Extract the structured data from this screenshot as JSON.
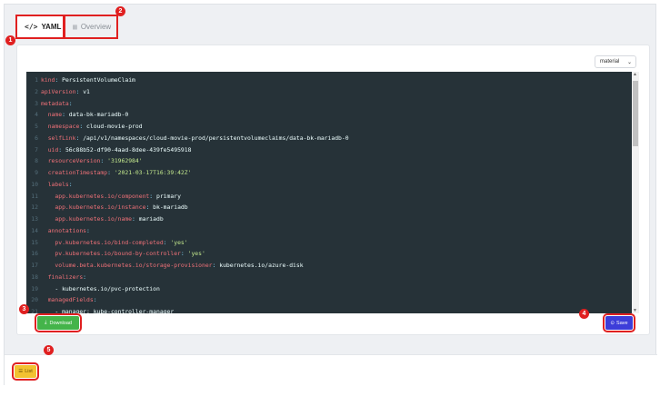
{
  "tabs": [
    {
      "label": "YAML",
      "icon": "code-icon"
    },
    {
      "label": "Overview",
      "icon": "grid-icon"
    }
  ],
  "theme_select": {
    "value": "material"
  },
  "editor": {
    "lines": [
      {
        "n": "1",
        "key": "kind",
        "val": " PersistentVolumeClaim",
        "cls": "v"
      },
      {
        "n": "2",
        "key": "apiVersion",
        "val": " v1",
        "cls": "v"
      },
      {
        "n": "3",
        "key": "metadata",
        "val": "",
        "cls": "v"
      },
      {
        "n": "4",
        "key": "  name",
        "val": " data-bk-mariadb-0",
        "cls": "v"
      },
      {
        "n": "5",
        "key": "  namespace",
        "val": " cloud-movie-prod",
        "cls": "v"
      },
      {
        "n": "6",
        "key": "  selfLink",
        "val": " /api/v1/namespaces/cloud-movie-prod/persistentvolumeclaims/data-bk-mariadb-0",
        "cls": "v"
      },
      {
        "n": "7",
        "key": "  uid",
        "val": " 56c88b52-df90-4aad-8dee-439fe5495918",
        "cls": "v"
      },
      {
        "n": "8",
        "key": "  resourceVersion",
        "val": " '31962984'",
        "cls": "s"
      },
      {
        "n": "9",
        "key": "  creationTimestamp",
        "val": " '2021-03-17T16:39:42Z'",
        "cls": "s"
      },
      {
        "n": "10",
        "key": "  labels",
        "val": "",
        "cls": "v"
      },
      {
        "n": "11",
        "key": "    app.kubernetes.io/component",
        "val": " primary",
        "cls": "v"
      },
      {
        "n": "12",
        "key": "    app.kubernetes.io/instance",
        "val": " bk-mariadb",
        "cls": "v"
      },
      {
        "n": "13",
        "key": "    app.kubernetes.io/name",
        "val": " mariadb",
        "cls": "v"
      },
      {
        "n": "14",
        "key": "  annotations",
        "val": "",
        "cls": "v"
      },
      {
        "n": "15",
        "key": "    pv.kubernetes.io/bind-completed",
        "val": " 'yes'",
        "cls": "s"
      },
      {
        "n": "16",
        "key": "    pv.kubernetes.io/bound-by-controller",
        "val": " 'yes'",
        "cls": "s"
      },
      {
        "n": "17",
        "key": "    volume.beta.kubernetes.io/storage-provisioner",
        "val": " kubernetes.io/azure-disk",
        "cls": "v"
      },
      {
        "n": "18",
        "key": "  finalizers",
        "val": "",
        "cls": "v"
      },
      {
        "n": "19",
        "key": "",
        "val": "    - kubernetes.io/pvc-protection",
        "cls": "v"
      },
      {
        "n": "20",
        "key": "  managedFields",
        "val": "",
        "cls": "v"
      },
      {
        "n": "21",
        "key": "",
        "val": "    - manager: kube-controller-manager",
        "cls": "v"
      }
    ]
  },
  "buttons": {
    "download": "Download",
    "save": "Save",
    "list": "List"
  },
  "badges": [
    "1",
    "2",
    "3",
    "4",
    "5"
  ],
  "colors": {
    "annotation_red": "#e02020",
    "download_green": "#44b44a",
    "save_blue": "#3d3dd9",
    "list_yellow": "#f2c230",
    "editor_bg": "#263238"
  }
}
